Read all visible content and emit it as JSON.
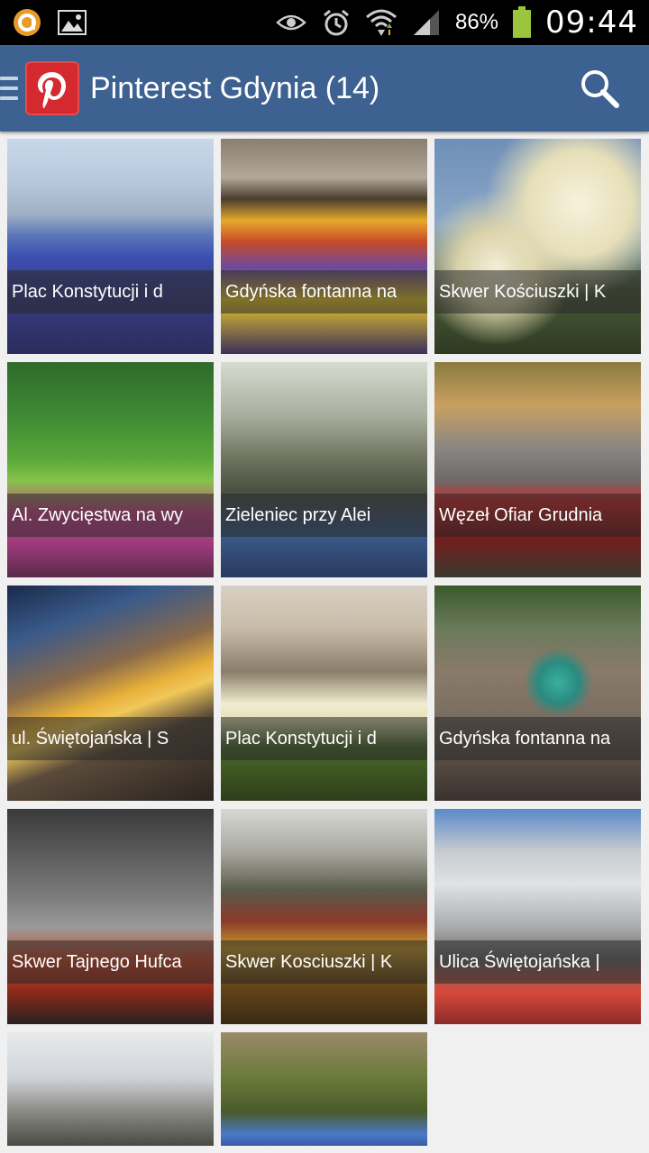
{
  "status_bar": {
    "battery_percent": "86%",
    "time": "09:44",
    "icons": [
      "app-notification-icon",
      "image-notification-icon",
      "eye-icon",
      "alarm-icon",
      "wifi-icon",
      "signal-icon",
      "battery-icon"
    ]
  },
  "action_bar": {
    "title": "Pinterest Gdynia (14)",
    "icons": [
      "drawer-icon",
      "pinterest-logo-icon",
      "search-icon"
    ]
  },
  "colors": {
    "action_bar": "#3d6190",
    "status_bar": "#000000",
    "background": "#f0f0f0",
    "logo": "#d42a2f"
  },
  "pins": [
    {
      "caption": "Plac Konstytucji i d"
    },
    {
      "caption": "Gdyńska fontanna na"
    },
    {
      "caption": "Skwer Kościuszki | K"
    },
    {
      "caption": "Al. Zwycięstwa na wy"
    },
    {
      "caption": "Zieleniec przy Alei"
    },
    {
      "caption": "Węzeł Ofiar Grudnia"
    },
    {
      "caption": "ul. Świętojańska | S"
    },
    {
      "caption": "Plac Konstytucji i d"
    },
    {
      "caption": "Gdyńska fontanna na"
    },
    {
      "caption": "Skwer Tajnego Hufca"
    },
    {
      "caption": "Skwer Kosciuszki | K"
    },
    {
      "caption": "Ulica Świętojańska |"
    },
    {
      "caption": ""
    },
    {
      "caption": ""
    }
  ]
}
